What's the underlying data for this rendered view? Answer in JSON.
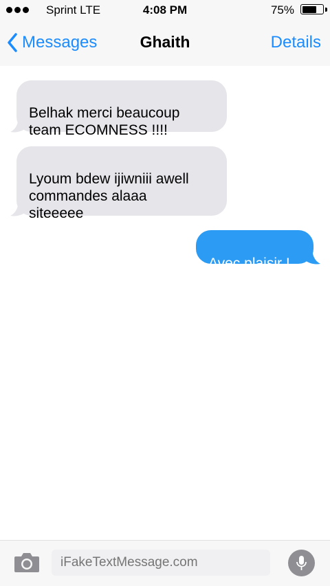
{
  "status_bar": {
    "carrier": "Sprint  LTE",
    "time": "4:08 PM",
    "battery_percent_label": "75%",
    "battery_level": 0.75
  },
  "nav": {
    "back_label": "Messages",
    "title": "Ghaith",
    "details_label": "Details"
  },
  "messages": [
    {
      "direction": "incoming",
      "text": "Belhak merci beaucoup\nteam ECOMNESS !!!!"
    },
    {
      "direction": "incoming",
      "text": "Lyoum bdew ijiwniii awell\ncommandes alaaa\nsiteeeee"
    },
    {
      "direction": "outgoing",
      "text": "Avec plaisir !"
    }
  ],
  "compose": {
    "placeholder": "iFakeTextMessage.com"
  },
  "colors": {
    "accent": "#1a8cff",
    "incoming_bubble": "#e5e5ea",
    "outgoing_bubble": "#2b9bf4",
    "bar_background": "#f7f7f7"
  },
  "icons": {
    "back": "chevron-left-icon",
    "camera": "camera-icon",
    "mic": "microphone-icon",
    "battery": "battery-icon",
    "signal": "signal-dots-icon"
  }
}
